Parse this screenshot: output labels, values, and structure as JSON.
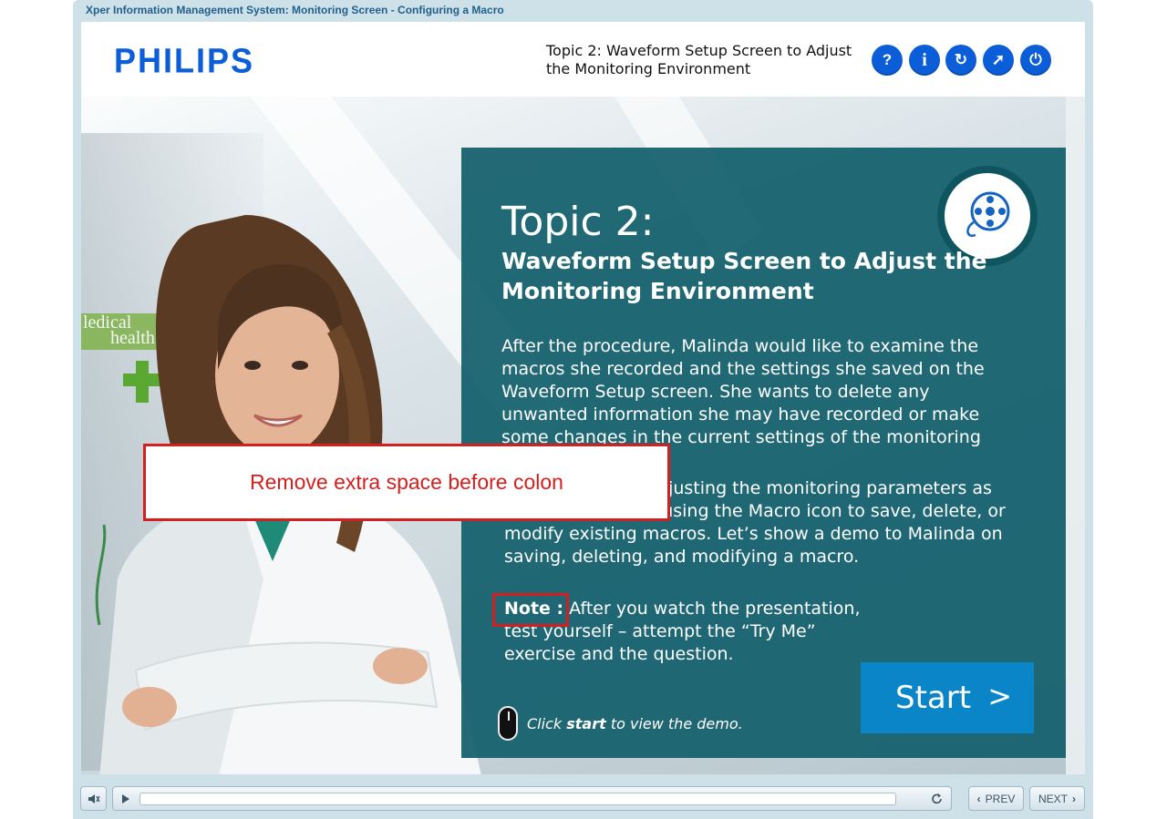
{
  "window": {
    "title": "Xper Information Management System: Monitoring Screen - Configuring a Macro"
  },
  "header": {
    "logo": "PHILIPS",
    "topic_line1": "Topic 2: Waveform Setup Screen to Adjust",
    "topic_line2": "the Monitoring Environment",
    "icons": [
      {
        "name": "help-icon",
        "glyph": "?"
      },
      {
        "name": "info-icon",
        "glyph": "i"
      },
      {
        "name": "replay-icon",
        "glyph": "↻"
      },
      {
        "name": "compass-icon",
        "glyph": "➚"
      },
      {
        "name": "power-icon",
        "glyph": "⏻"
      }
    ],
    "brand_color": "#0b5ed7"
  },
  "panel": {
    "title": "Topic 2:",
    "subtitle": "Waveform Setup Screen to Adjust the Monitoring Environment",
    "body1": "After the procedure, Malinda would like to examine the macros she recorded and the settings she saved on the Waveform Setup screen. She wants to delete any unwanted information she may have recorded or make some changes in the current settings of the monitoring",
    "body2": "environment by adjusting the monitoring parameters as desired, and then using the Macro icon to save, delete, or modify existing macros. Let’s show a demo to Malinda on saving, deleting, and modifying a macro.",
    "note_label": "Note :",
    "note_text": " After you watch the presentation, test yourself – attempt the “Try Me” exercise and the question.",
    "start_label": "Start",
    "start_arrow": ">",
    "hint_prefix": "Click ",
    "hint_bold": "start",
    "hint_suffix": " to view the demo.",
    "panel_color": "#125f6c",
    "start_color": "#0a86c8"
  },
  "background_sign": {
    "line1": "ledical",
    "line2": "health"
  },
  "callout": {
    "text": "Remove extra space before colon",
    "color": "#d41f1f"
  },
  "player": {
    "prev_label": "PREV",
    "next_label": "NEXT"
  }
}
